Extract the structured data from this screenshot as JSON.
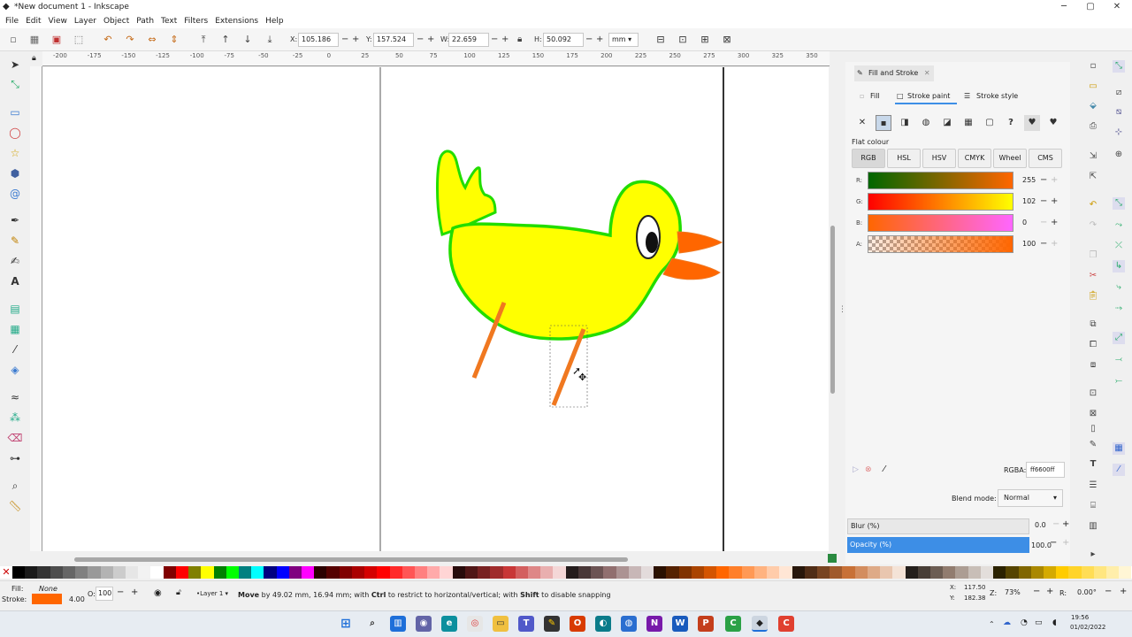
{
  "window": {
    "title": "*New document 1 - Inkscape",
    "minimize": "─",
    "maximize": "▢",
    "close": "✕"
  },
  "menu": [
    "File",
    "Edit",
    "View",
    "Layer",
    "Object",
    "Path",
    "Text",
    "Filters",
    "Extensions",
    "Help"
  ],
  "toolctrl": {
    "x_label": "X:",
    "x_value": "105.186",
    "y_label": "Y:",
    "y_value": "157.524",
    "w_label": "W:",
    "w_value": "22.659",
    "h_label": "H:",
    "h_value": "50.092",
    "unit": "mm"
  },
  "ruler_labels": [
    "-200",
    "-175",
    "-150",
    "-125",
    "-100",
    "-75",
    "-50",
    "-25",
    "0",
    "25",
    "50",
    "75",
    "100",
    "125",
    "150",
    "175",
    "200",
    "225",
    "250",
    "275",
    "300",
    "325",
    "350"
  ],
  "dock": {
    "tab_title": "Fill and Stroke",
    "subtabs": {
      "fill": "Fill",
      "stroke_paint": "Stroke paint",
      "stroke_style": "Stroke style"
    },
    "flat_colour_label": "Flat colour",
    "models": [
      "RGB",
      "HSL",
      "HSV",
      "CMYK",
      "Wheel",
      "CMS"
    ],
    "active_model": "RGB",
    "sliders": [
      {
        "label": "R:",
        "value": "255"
      },
      {
        "label": "G:",
        "value": "102"
      },
      {
        "label": "B:",
        "value": "0"
      },
      {
        "label": "A:",
        "value": "100"
      }
    ],
    "rgba_label": "RGBA:",
    "rgba_value": "ff6600ff",
    "blend_label": "Blend mode:",
    "blend_value": "Normal",
    "blur_label": "Blur (%)",
    "blur_value": "0.0",
    "opacity_label": "Opacity (%)",
    "opacity_value": "100.0"
  },
  "status": {
    "fill_label": "Fill:",
    "fill_value": "None",
    "stroke_label": "Stroke:",
    "stroke_width": "4.00",
    "stroke_color": "#ff6600",
    "opacity_label": "O:",
    "opacity_value": "100",
    "layer": "•Layer 1",
    "message_bold1": "Move",
    "message_part1": " by 49.02 mm, 16.94 mm; with ",
    "message_bold2": "Ctrl",
    "message_part2": " to restrict to horizontal/vertical; with ",
    "message_bold3": "Shift",
    "message_part3": " to disable snapping",
    "cursor_x_label": "X:",
    "cursor_x": "117.50",
    "cursor_y_label": "Y:",
    "cursor_y": "182.38",
    "zoom_label": "Z:",
    "zoom": "73%",
    "rotation_label": "R:",
    "rotation": "0.00°"
  },
  "clock": {
    "time": "19:56",
    "date": "01/02/2022"
  },
  "colors": {
    "accent_blue": "#3d8ee6",
    "bird_fill": "#ffff00",
    "bird_stroke": "#22dd00",
    "beak": "#ff6600",
    "legs": "#f07820"
  }
}
